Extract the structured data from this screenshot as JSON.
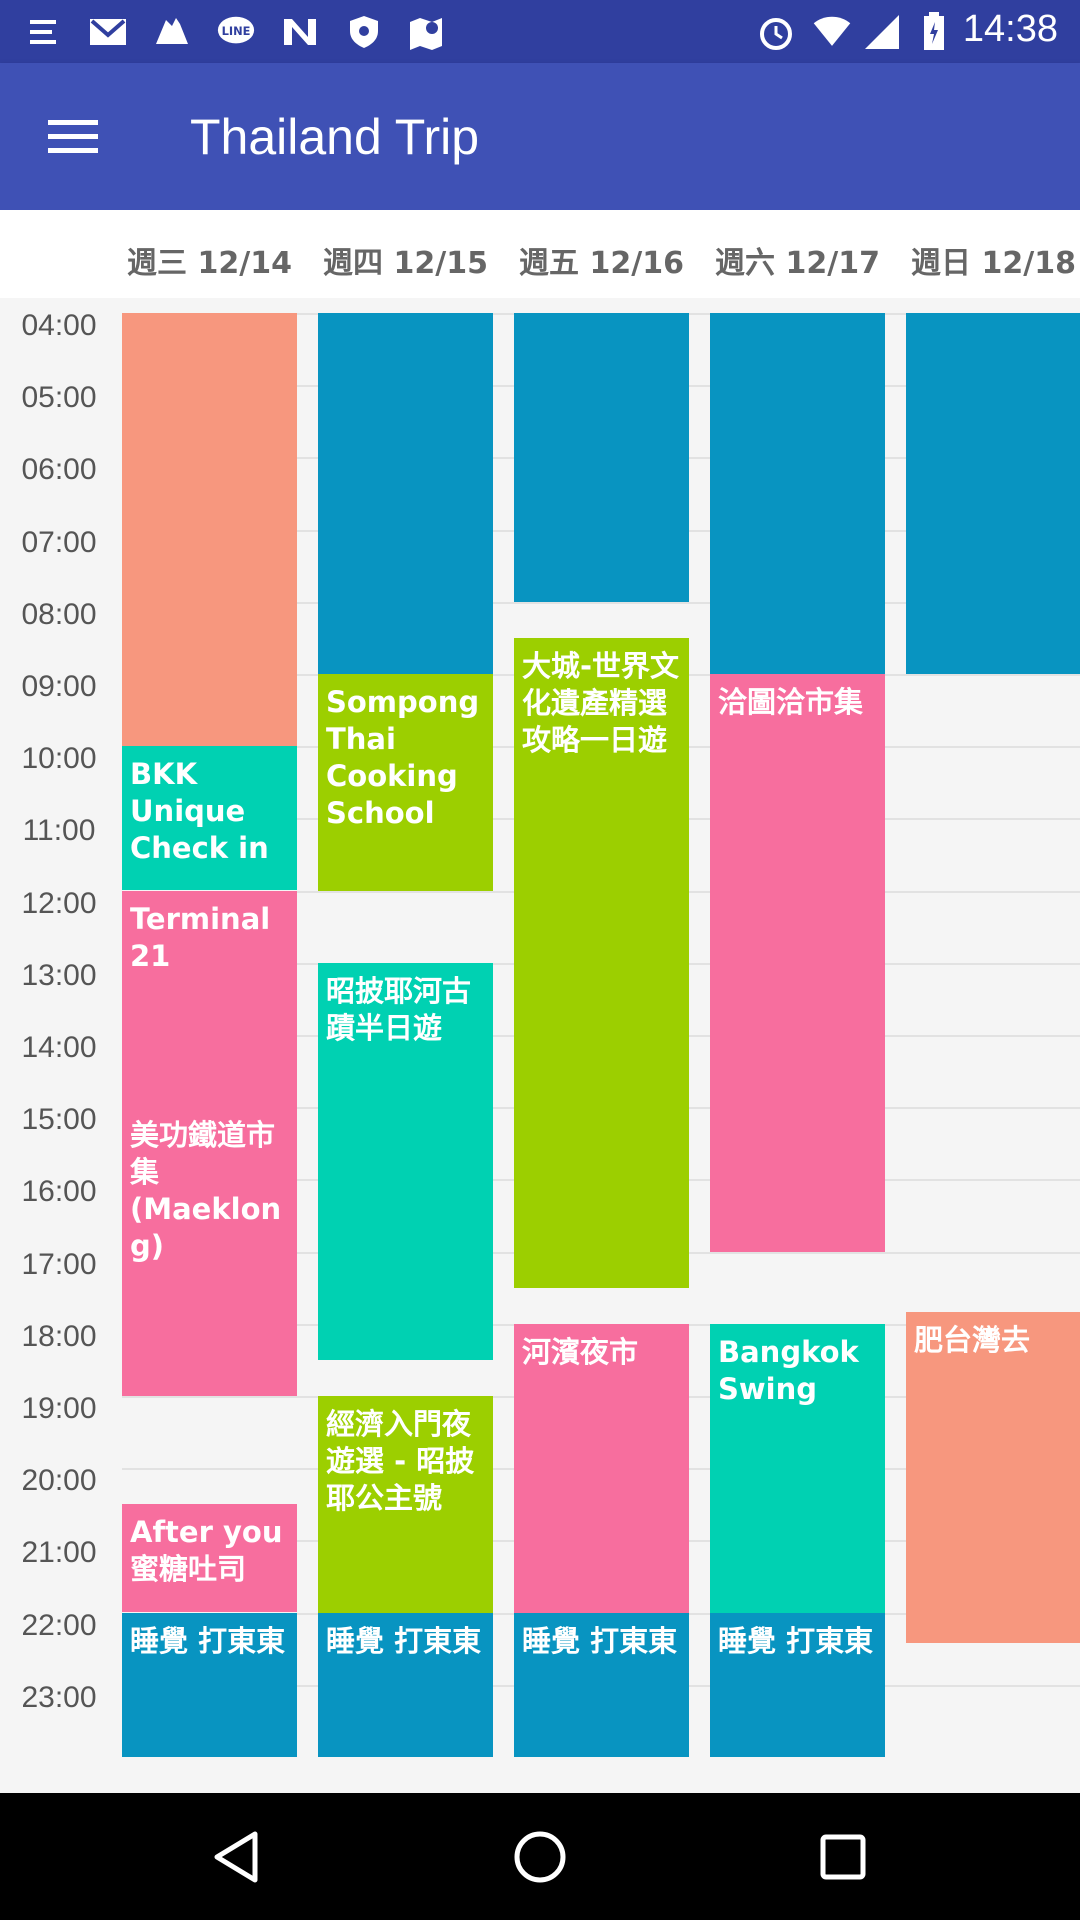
{
  "status_bar": {
    "time": "14:38",
    "notification_icons": [
      "notification-icon",
      "gmail-icon",
      "shoe-icon",
      "line-icon",
      "n-app-icon",
      "vpn-shield-icon",
      "maps-icon"
    ],
    "system_icons": [
      "alarm-icon",
      "wifi-icon",
      "cell-signal-icon",
      "battery-icon"
    ]
  },
  "app_bar": {
    "title": "Thailand Trip",
    "menu_icon": "hamburger-menu-icon",
    "background": "#3f51b5"
  },
  "days": [
    {
      "label": "週三 12/14"
    },
    {
      "label": "週四 12/15"
    },
    {
      "label": "週五 12/16"
    },
    {
      "label": "週六 12/17"
    },
    {
      "label": "週日 12/18"
    }
  ],
  "hours": [
    "04:00",
    "05:00",
    "06:00",
    "07:00",
    "08:00",
    "09:00",
    "10:00",
    "11:00",
    "12:00",
    "13:00",
    "14:00",
    "15:00",
    "16:00",
    "17:00",
    "18:00",
    "19:00",
    "20:00",
    "21:00",
    "22:00",
    "23:00"
  ],
  "colors": {
    "blue": "#0894c1",
    "salmon": "#f7977e",
    "teal": "#00d1b2",
    "green": "#9ccf00",
    "pink": "#f76e9e"
  },
  "events": [
    {
      "day": 0,
      "start": "04:00",
      "end": "10:00",
      "color": "salmon",
      "title": ""
    },
    {
      "day": 0,
      "start": "10:00",
      "end": "12:00",
      "color": "teal",
      "title": "BKK Unique Check in"
    },
    {
      "day": 0,
      "start": "12:00",
      "end": "19:00",
      "color": "pink",
      "title": "Terminal 21"
    },
    {
      "day": 0,
      "start": "15:00",
      "end": "19:00",
      "color": "pink",
      "title": "美功鐵道市集(Maeklong)"
    },
    {
      "day": 0,
      "start": "20:30",
      "end": "22:00",
      "color": "pink",
      "title": "After you 蜜糖吐司"
    },
    {
      "day": 0,
      "start": "22:00",
      "end": "24:00",
      "color": "blue",
      "title": "睡覺 打東東"
    },
    {
      "day": 1,
      "start": "04:00",
      "end": "09:00",
      "color": "blue",
      "title": ""
    },
    {
      "day": 1,
      "start": "09:00",
      "end": "12:00",
      "color": "green",
      "title": "Sompong Thai Cooking School"
    },
    {
      "day": 1,
      "start": "13:00",
      "end": "18:30",
      "color": "teal",
      "title": "昭披耶河古蹟半日遊"
    },
    {
      "day": 1,
      "start": "19:00",
      "end": "22:00",
      "color": "green",
      "title": "經濟入門夜遊選 - 昭披耶公主號"
    },
    {
      "day": 1,
      "start": "22:00",
      "end": "24:00",
      "color": "blue",
      "title": "睡覺 打東東"
    },
    {
      "day": 2,
      "start": "04:00",
      "end": "08:00",
      "color": "blue",
      "title": ""
    },
    {
      "day": 2,
      "start": "08:30",
      "end": "17:30",
      "color": "green",
      "title": "大城-世界文化遺產精選攻略一日遊"
    },
    {
      "day": 2,
      "start": "18:00",
      "end": "22:00",
      "color": "pink",
      "title": "河濱夜市"
    },
    {
      "day": 2,
      "start": "22:00",
      "end": "24:00",
      "color": "blue",
      "title": "睡覺 打東東"
    },
    {
      "day": 3,
      "start": "04:00",
      "end": "09:00",
      "color": "blue",
      "title": ""
    },
    {
      "day": 3,
      "start": "09:00",
      "end": "17:00",
      "color": "pink",
      "title": "洽圖洽市集"
    },
    {
      "day": 3,
      "start": "18:00",
      "end": "22:00",
      "color": "teal",
      "title": "Bangkok Swing"
    },
    {
      "day": 3,
      "start": "22:00",
      "end": "24:00",
      "color": "blue",
      "title": "睡覺 打東東"
    },
    {
      "day": 4,
      "start": "04:00",
      "end": "09:00",
      "color": "blue",
      "title": ""
    },
    {
      "day": 4,
      "start": "17:50",
      "end": "22:25",
      "color": "salmon",
      "title": "肥台灣去"
    }
  ],
  "nav_bar": {
    "back_icon": "back-triangle-icon",
    "home_icon": "home-circle-icon",
    "recents_icon": "recents-square-icon"
  }
}
